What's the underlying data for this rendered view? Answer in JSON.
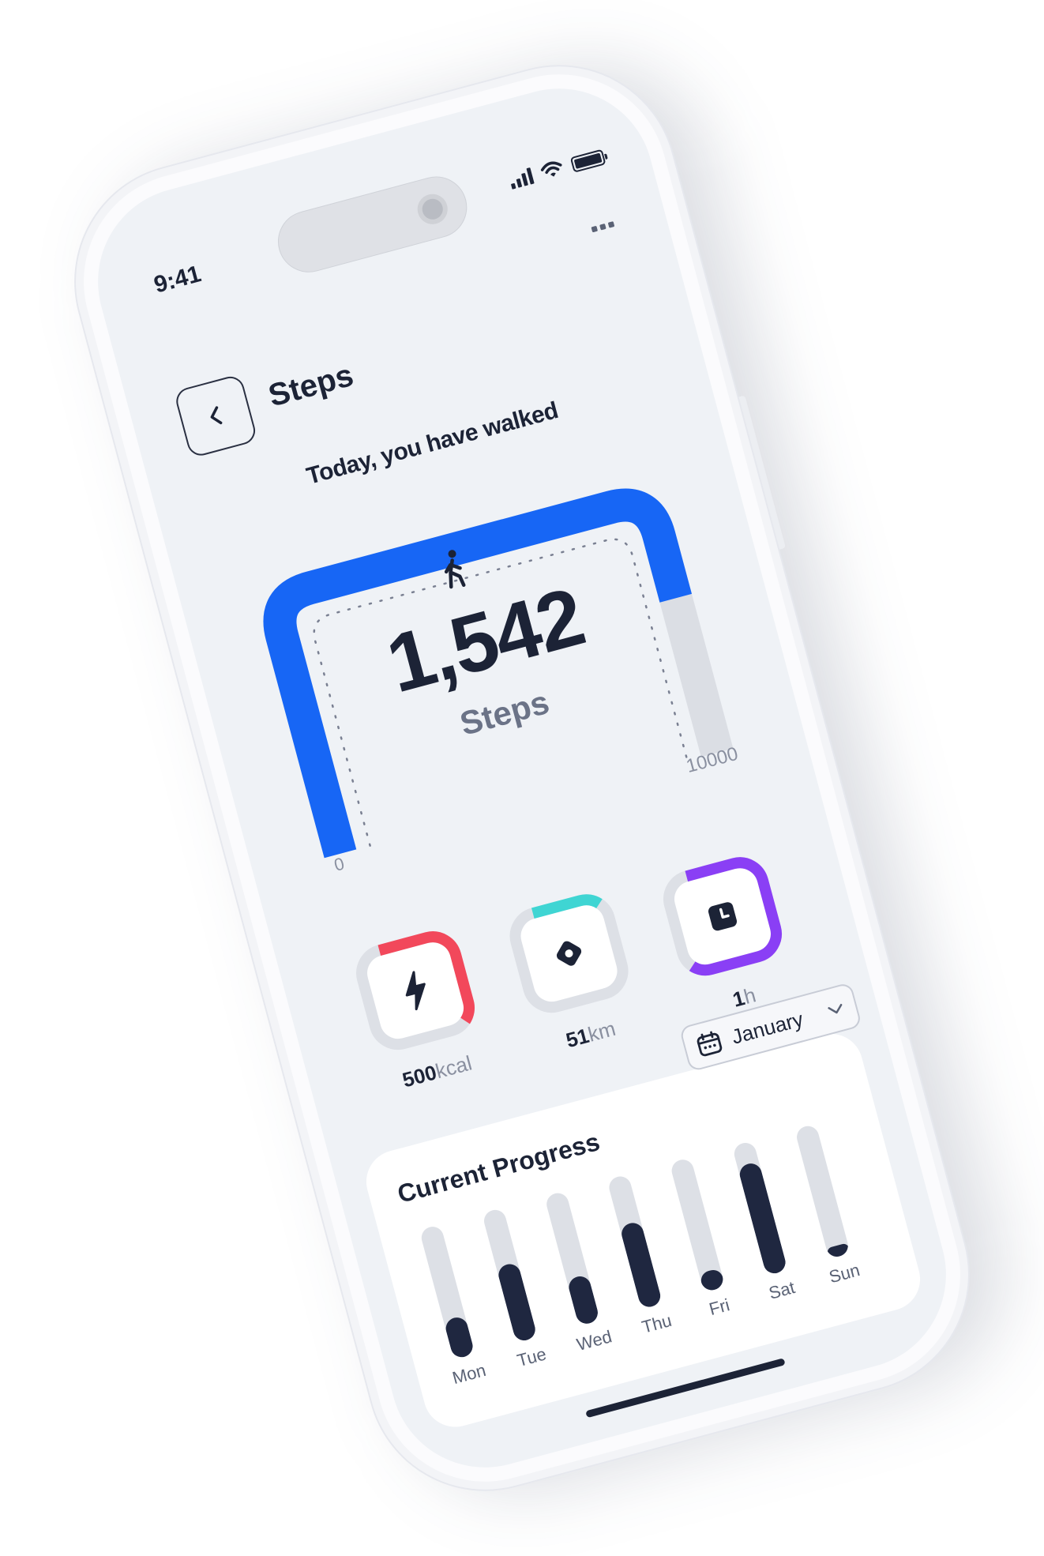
{
  "status_bar": {
    "time": "9:41"
  },
  "header": {
    "title": "Steps"
  },
  "summary": {
    "intro": "Today, you have walked",
    "steps_value": "1,542",
    "steps_unit": "Steps",
    "gauge_min": "0",
    "gauge_max": "10000",
    "gauge_progress": 0.82,
    "colors": {
      "accent": "#1766f5",
      "track": "#dbdee4"
    }
  },
  "stats": [
    {
      "value": "500",
      "unit": "kcal",
      "icon": "lightning-icon",
      "color": "#f2485b",
      "progress": 0.45
    },
    {
      "value": "51",
      "unit": "km",
      "icon": "location-pin-icon",
      "color": "#3fd5d3",
      "progress": 0.2
    },
    {
      "value": "1",
      "unit": "h",
      "icon": "clock-icon",
      "color": "#8a3ff5",
      "progress": 0.7
    }
  ],
  "progress": {
    "title": "Current Progress",
    "month": "January",
    "days": [
      {
        "label": "Mon",
        "value": 0.3
      },
      {
        "label": "Tue",
        "value": 0.58
      },
      {
        "label": "Wed",
        "value": 0.36
      },
      {
        "label": "Thu",
        "value": 0.64
      },
      {
        "label": "Fri",
        "value": 0.15
      },
      {
        "label": "Sat",
        "value": 0.84
      },
      {
        "label": "Sun",
        "value": 0.08
      }
    ]
  }
}
